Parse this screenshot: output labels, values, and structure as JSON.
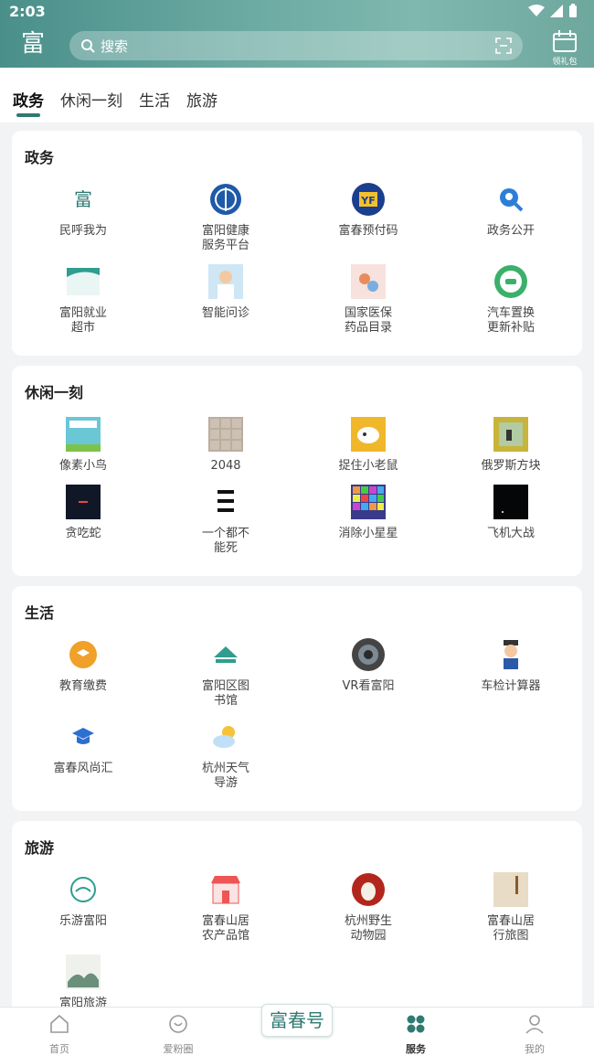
{
  "status_bar": {
    "time": "2:03"
  },
  "header": {
    "logo_text": "富",
    "search_placeholder": "搜索",
    "checkin_label": "领礼包"
  },
  "tabs": [
    {
      "label": "政务",
      "active": true
    },
    {
      "label": "休闲一刻",
      "active": false
    },
    {
      "label": "生活",
      "active": false
    },
    {
      "label": "旅游",
      "active": false
    }
  ],
  "sections": [
    {
      "title": "政务",
      "items": [
        {
          "label": "民呼我为",
          "icon": "minhu-icon"
        },
        {
          "label": "富阳健康\n服务平台",
          "icon": "health-platform-icon"
        },
        {
          "label": "富春预付码",
          "icon": "prepay-code-icon"
        },
        {
          "label": "政务公开",
          "icon": "gov-open-icon"
        },
        {
          "label": "富阳就业\n超市",
          "icon": "employment-market-icon"
        },
        {
          "label": "智能问诊",
          "icon": "smart-consult-icon"
        },
        {
          "label": "国家医保\n药品目录",
          "icon": "medical-insurance-icon"
        },
        {
          "label": "汽车置换\n更新补贴",
          "icon": "car-subsidy-icon"
        }
      ]
    },
    {
      "title": "休闲一刻",
      "items": [
        {
          "label": "像素小鸟",
          "icon": "pixel-bird-icon"
        },
        {
          "label": "2048",
          "icon": "game-2048-icon"
        },
        {
          "label": "捉住小老鼠",
          "icon": "catch-mouse-icon"
        },
        {
          "label": "俄罗斯方块",
          "icon": "tetris-icon"
        },
        {
          "label": "贪吃蛇",
          "icon": "snake-icon"
        },
        {
          "label": "一个都不\n能死",
          "icon": "none-die-icon"
        },
        {
          "label": "消除小星星",
          "icon": "pop-star-icon"
        },
        {
          "label": "飞机大战",
          "icon": "plane-war-icon"
        }
      ]
    },
    {
      "title": "生活",
      "items": [
        {
          "label": "教育缴费",
          "icon": "education-fee-icon"
        },
        {
          "label": "富阳区图\n书馆",
          "icon": "library-icon"
        },
        {
          "label": "VR看富阳",
          "icon": "vr-icon"
        },
        {
          "label": "车检计算器",
          "icon": "car-inspection-icon"
        },
        {
          "label": "富春风尚汇",
          "icon": "graduation-icon"
        },
        {
          "label": "杭州天气\n导游",
          "icon": "weather-icon"
        }
      ]
    },
    {
      "title": "旅游",
      "items": [
        {
          "label": "乐游富阳",
          "icon": "travel-fuyang-icon"
        },
        {
          "label": "富春山居\n农产品馆",
          "icon": "farm-store-icon"
        },
        {
          "label": "杭州野生\n动物园",
          "icon": "zoo-icon"
        },
        {
          "label": "富春山居\n行旅图",
          "icon": "painting-icon"
        },
        {
          "label": "富阳旅游",
          "icon": "fuyang-travel-icon"
        }
      ]
    }
  ],
  "bottom_nav": [
    {
      "label": "首页",
      "icon": "home-icon",
      "active": false
    },
    {
      "label": "爱粉圈",
      "icon": "fan-circle-icon",
      "active": false
    },
    {
      "label": "富春号",
      "icon": "fuchun-logo",
      "active": false
    },
    {
      "label": "服务",
      "icon": "service-icon",
      "active": true
    },
    {
      "label": "我的",
      "icon": "profile-icon",
      "active": false
    }
  ],
  "colors": {
    "brand": "#2f7a72",
    "header": "#5e9f98"
  }
}
